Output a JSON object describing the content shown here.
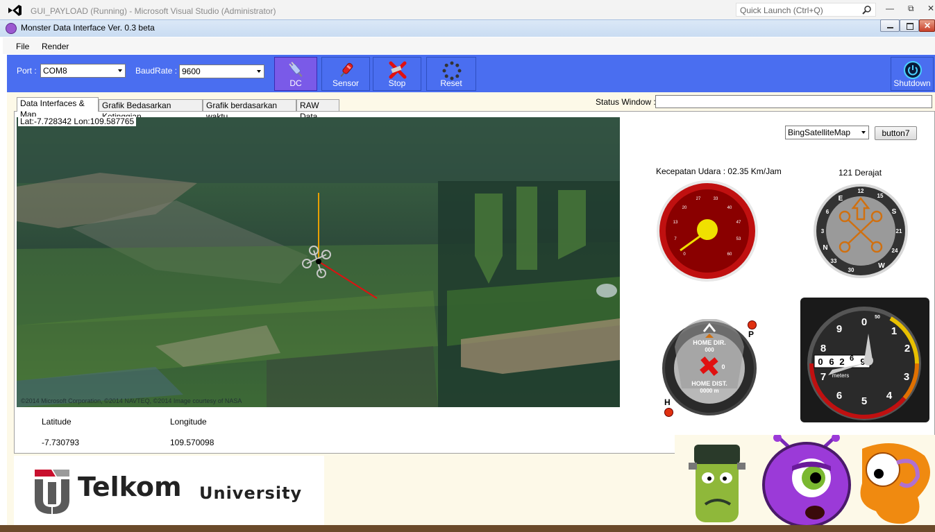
{
  "vs": {
    "title": "GUI_PAYLOAD (Running) - Microsoft Visual Studio (Administrator)",
    "quick_launch": "Quick Launch (Ctrl+Q)"
  },
  "app": {
    "title": "Monster Data Interface Ver. 0.3 beta"
  },
  "menu": [
    "File",
    "Render"
  ],
  "toolbar": {
    "port_label": "Port :",
    "port_value": "COM8",
    "baud_label": "BaudRate :",
    "baud_value": "9600",
    "buttons": [
      "DC",
      "Sensor",
      "Stop",
      "Reset"
    ],
    "shutdown": "Shutdown"
  },
  "tabs": [
    "Data Interfaces & Map",
    "Grafik Bedasarkan Ketinggian",
    "Grafik berdasarkan waktu",
    "RAW Data"
  ],
  "status_label": "Status Window :",
  "map": {
    "latlon": "Lat:-7.728342 Lon:109.587765",
    "copyright": "©2014 Microsoft Corporation, ©2014 NAVTEQ, ©2014 Image courtesy of NASA",
    "type": "BingSatelliteMap",
    "button": "button7"
  },
  "coords": {
    "lat_label": "Latitude",
    "lon_label": "Longitude",
    "lat_value": "-7.730793",
    "lon_value": "109.570098"
  },
  "gauges": {
    "speed_label": "Kecepatan Udara :  02.35 Km/Jam",
    "speed_ticks": [
      "0",
      "7",
      "13",
      "20",
      "27",
      "33",
      "40",
      "47",
      "53",
      "60"
    ],
    "heading_label": "121 Derajat",
    "compass_ticks": [
      "12",
      "15",
      "S",
      "21",
      "24",
      "W",
      "30",
      "33",
      "N",
      "3",
      "6",
      "E"
    ],
    "home_dir": "HOME DIR.",
    "home_dir_value": "000",
    "home_dist": "HOME DIST.",
    "home_dist_value": "0000 m",
    "home_side": "0",
    "p_label": "P",
    "h_label": "H",
    "alt_ticks": [
      "0",
      "1",
      "2",
      "3",
      "4",
      "5",
      "6",
      "7",
      "8",
      "9"
    ],
    "alt_small": "50",
    "alt_digits": [
      "0",
      "6",
      "2",
      "6",
      "9"
    ],
    "alt_unit": "meters"
  },
  "logo": {
    "name": "Telkom",
    "sub": "University"
  },
  "colors": {
    "toolbar": "#4a6ef0",
    "dc_button": "#7a5ae8",
    "speed_gauge": "#c01010",
    "accent": "#e8d000"
  }
}
